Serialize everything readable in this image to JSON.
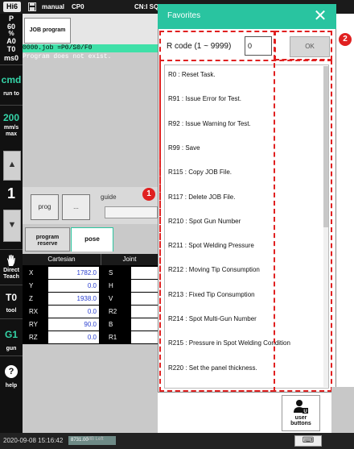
{
  "topbar": {
    "logo": "Hi6",
    "mode": "manual",
    "cp": "CP0",
    "cn": "CN:I SQ:"
  },
  "left": {
    "p_label": "P",
    "speed_pct": "60",
    "pct_sign": "%",
    "a": "A0",
    "t": "T0",
    "ms": "ms0",
    "cmd": "cmd",
    "run_to": "run to",
    "speed": "200",
    "speed_unit": "mm/s",
    "speed_max": "max",
    "up": "▲",
    "step": "1",
    "down": "▼",
    "direct_teach_line1": "Direct",
    "direct_teach_line2": "Teach",
    "tool_val": "T0",
    "tool": "tool",
    "gun_val": "G1",
    "gun": "gun",
    "help_icon": "?",
    "help": "help"
  },
  "main": {
    "tab_job": "JOB program",
    "job_line": "0000.job  =P0/S0/F0",
    "msg_line": "Program does not exist.",
    "prog_btn": "prog",
    "dots_btn": "...",
    "guide": "guide",
    "tab_reserve_line1": "program",
    "tab_reserve_line2": "reserve",
    "tab_pose": "pose"
  },
  "pose_table": {
    "header_cartesian": "Cartesian",
    "header_joint": "Joint",
    "rows": [
      {
        "axis": "X",
        "value": "1782.0",
        "joint": "S"
      },
      {
        "axis": "Y",
        "value": "0.0",
        "joint": "H"
      },
      {
        "axis": "Z",
        "value": "1938.0",
        "joint": "V"
      },
      {
        "axis": "RX",
        "value": "0.0",
        "joint": "R2"
      },
      {
        "axis": "RY",
        "value": "90.0",
        "joint": "B"
      },
      {
        "axis": "RZ",
        "value": "0.0",
        "joint": "R1"
      }
    ]
  },
  "favorites": {
    "title": "Favorites",
    "close": "✕",
    "rcode_label": "R code (1 ~ 9999)",
    "rcode_value": "0",
    "ok": "OK",
    "items": [
      "R0 : Reset Task.",
      "R91 : Issue Error for Test.",
      "R92 : Issue Warning for Test.",
      "R99 : Save",
      "R115 : Copy JOB File.",
      "R117 : Delete JOB File.",
      "R210 : Spot Gun Number",
      "R211 : Spot Welding Pressure",
      "R212 : Moving Tip Consumption",
      "R213 : Fixed Tip Consumption",
      "R214 : Spot Multi-Gun Number",
      "R215 : Pressure in Spot Welding Condition",
      "R220 : Set the panel thickness."
    ]
  },
  "annotations": {
    "badge1": "1",
    "badge2": "2"
  },
  "user_buttons": {
    "line1": "user",
    "line2": "buttons"
  },
  "bottom": {
    "datetime": "2020-09-08 15:16:42",
    "memory": "8731.00",
    "memory_unit": "MB Left",
    "keyboard": "⌨"
  },
  "colors": {
    "accent": "#29c4a0",
    "job_line": "#3fe0a8",
    "annotation": "#e02020",
    "value_text": "#2a3fcf"
  }
}
